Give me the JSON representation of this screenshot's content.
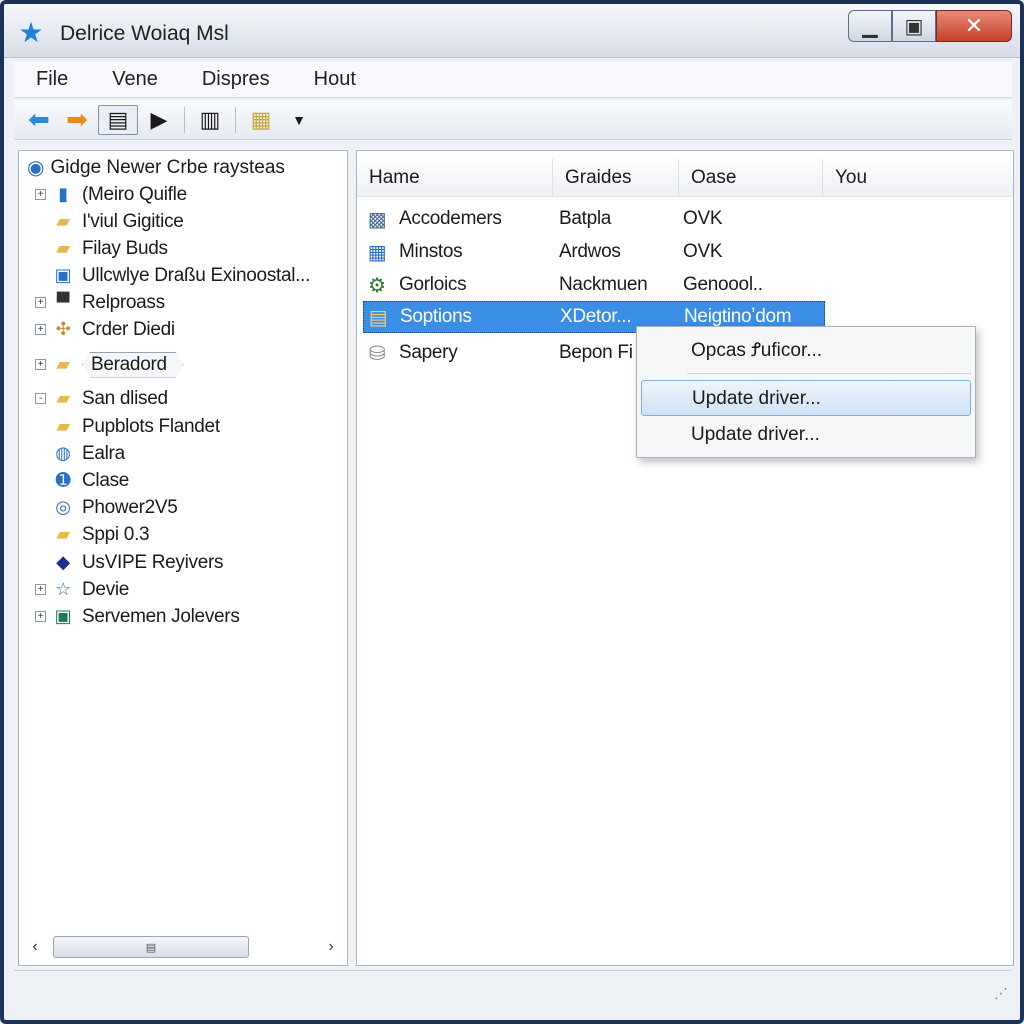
{
  "window": {
    "title": "Delrice Woiaq Msl"
  },
  "menu": [
    "File",
    "Vene",
    "Dispres",
    "Hout"
  ],
  "tree": {
    "root": "Gidge Newer Crbe raysteas",
    "items": [
      {
        "label": "(Meiro Quifle",
        "icon": "device-icon",
        "expander": "+"
      },
      {
        "label": "I'viul Gigitice",
        "icon": "folder-icon",
        "expander": ""
      },
      {
        "label": "Filay Buds",
        "icon": "folder-icon",
        "expander": ""
      },
      {
        "label": "Ullcwlye Draßu Exinoostal...",
        "icon": "document-icon",
        "expander": ""
      },
      {
        "label": "Relproass",
        "icon": "chip-icon",
        "expander": "+"
      },
      {
        "label": "Crder Diedi",
        "icon": "network-icon",
        "expander": "+"
      },
      {
        "label": "Beradord",
        "icon": "folder-icon",
        "expander": "+"
      },
      {
        "label": "San dlised",
        "icon": "folder-icon",
        "expander": "-"
      },
      {
        "label": "Pupblots Flandet",
        "icon": "folder-icon",
        "expander": ""
      },
      {
        "label": "Ealra",
        "icon": "globe-icon",
        "expander": ""
      },
      {
        "label": "Clase",
        "icon": "info-icon",
        "expander": ""
      },
      {
        "label": "Phower2V5",
        "icon": "disc-icon",
        "expander": ""
      },
      {
        "label": "Sppi 0.3",
        "icon": "folder-icon",
        "expander": ""
      },
      {
        "label": "UsVIPE Reyivers",
        "icon": "diamond-icon",
        "expander": ""
      },
      {
        "label": "Devie",
        "icon": "star-icon",
        "expander": "+"
      },
      {
        "label": "Servemen Jolevers",
        "icon": "monitor-icon",
        "expander": "+"
      }
    ]
  },
  "columns": [
    "Hame",
    "Graides",
    "Oase",
    "You"
  ],
  "rows": [
    {
      "name": "Accodemers",
      "col2": "Batpla",
      "col3": "OVK",
      "icon": "cube-icon"
    },
    {
      "name": "Minstos",
      "col2": "Ardwos",
      "col3": "OVK",
      "icon": "hardware-icon"
    },
    {
      "name": "Gorloics",
      "col2": "Nackmuen",
      "col3": "Genoool..",
      "icon": "gear-icon"
    },
    {
      "name": "Soptions",
      "col2": "XDetor...",
      "col3": "Neigtinoʼdom",
      "icon": "board-icon"
    },
    {
      "name": "Sapery",
      "col2": "Bepon Fi",
      "col3": "",
      "icon": "drive-icon"
    }
  ],
  "context_menu": [
    "Opcas Ꝭuficor...",
    "Update driver...",
    "Update driver..."
  ],
  "colors": {
    "selection": "#3a8ee6",
    "frame": "#1c3157"
  }
}
